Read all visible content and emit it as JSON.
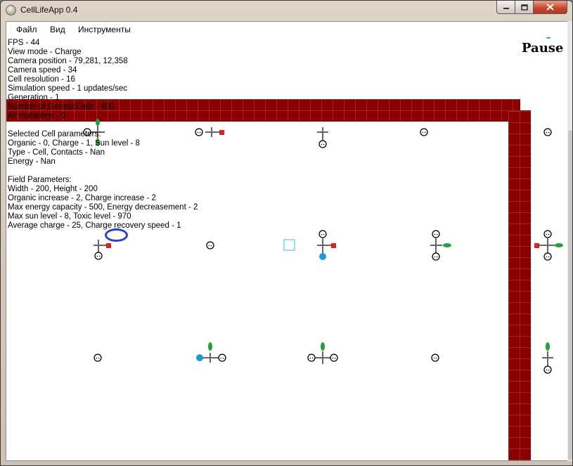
{
  "window": {
    "title": "CellLifeApp 0.4",
    "controls": {
      "minimize": "minimize-icon",
      "maximize": "maximize-icon",
      "close": "close-icon"
    }
  },
  "menu": [
    {
      "label": "Файл"
    },
    {
      "label": "Вид"
    },
    {
      "label": "Инструменты"
    }
  ],
  "stats": {
    "fps": "FPS - 44",
    "view_mode": "View mode - Charge",
    "camera_position": "Camera position - 79,281, 12,358",
    "camera_speed": "Camera speed - 34",
    "cell_resolution": "Cell resolution - 16",
    "simulation_speed": "Simulation speed - 1 updates/sec",
    "generation": "Generation - 1",
    "genetic_cells": "Number of GeneticCells - 400",
    "mutations": "All mutations - 0"
  },
  "selected_cell": {
    "header": "Selected Cell parameters:",
    "organic": "Organic - 0, Charge - 1, Sun level - 8",
    "type": "Type - Cell, Contacts - Nan",
    "energy": "Energy - Nan"
  },
  "field_params": {
    "header": "Field Parameters:",
    "size": "Width - 200, Height - 200",
    "organic": "Organic increase - 2, Charge increase - 2",
    "energy": "Max energy capacity - 500, Energy decreasement - 2",
    "sun_toxic": "Max sun level - 8, Toxic level - 970",
    "charge": "Average charge - 25, Charge recovery speed - 1"
  },
  "overlay": {
    "pause_label": "Pause"
  },
  "colors": {
    "wall": "#8b0000",
    "green_leaf": "#1fa33a",
    "red_block": "#e02020",
    "blue_ball": "#1a9ad6",
    "selection": "#59d6e0",
    "highlight": "#2a3fd6"
  }
}
